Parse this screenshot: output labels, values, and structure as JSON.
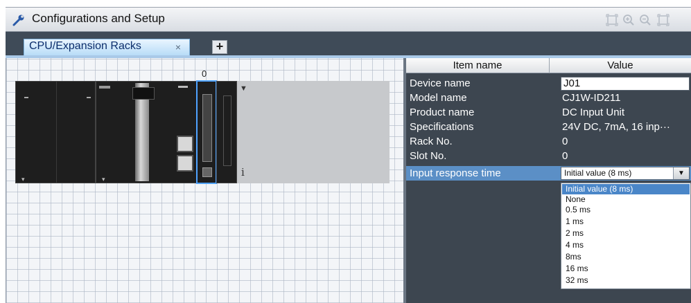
{
  "window": {
    "title": "Configurations and Setup",
    "tab_label": "CPU/Expansion Racks",
    "tab_close": "×",
    "add_tab": "+"
  },
  "rack": {
    "slot_number": "0",
    "info_glyph": "i"
  },
  "properties": {
    "header_name": "Item name",
    "header_value": "Value",
    "rows": [
      {
        "name": "Device name",
        "value": "J01"
      },
      {
        "name": "Model name",
        "value": "CJ1W-ID211"
      },
      {
        "name": "Product name",
        "value": "DC Input Unit"
      },
      {
        "name": "Specifications",
        "value": "24V DC, 7mA, 16 inp···"
      },
      {
        "name": "Rack No.",
        "value": "0"
      },
      {
        "name": "Slot No.",
        "value": "0"
      },
      {
        "name": "Input response time",
        "value": "Initial value (8 ms)"
      }
    ],
    "dropdown_options": [
      "Initial value (8 ms)",
      "None",
      "0.5 ms",
      "1 ms",
      "2 ms",
      "4 ms",
      "8ms",
      "16 ms",
      "32 ms"
    ]
  },
  "colors": {
    "selection_blue": "#4fa3ff",
    "panel_bg": "#3d4650",
    "row_highlight": "#5b8fc6"
  }
}
